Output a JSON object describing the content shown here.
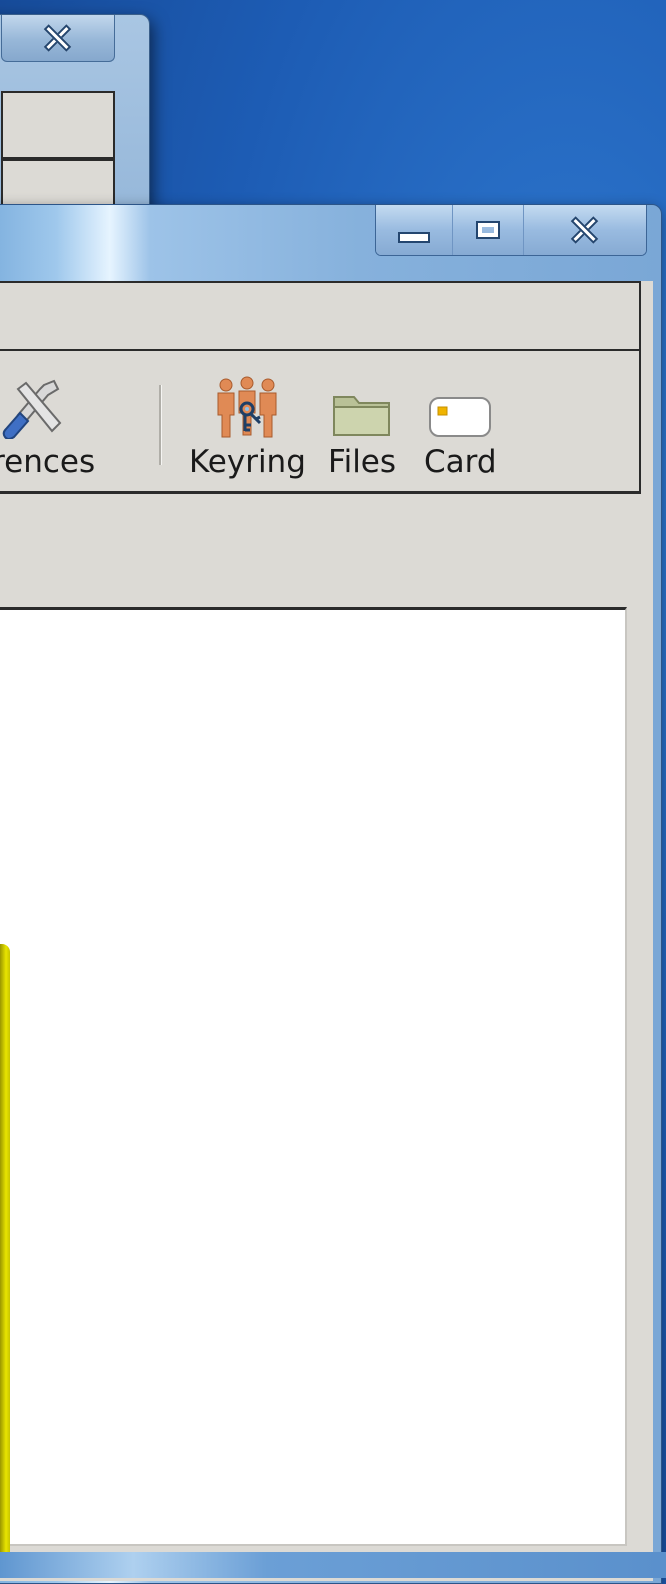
{
  "back_window": {
    "close_icon": "close-icon"
  },
  "main_window": {
    "caption_buttons": {
      "minimize_icon": "minimize-icon",
      "maximize_icon": "maximize-icon",
      "close_icon": "close-icon"
    },
    "toolbar": {
      "items": [
        {
          "label": "erences",
          "icon": "preferences-tools-icon"
        },
        {
          "label": "Keyring",
          "icon": "keyring-people-icon"
        },
        {
          "label": "Files",
          "icon": "folder-icon"
        },
        {
          "label": "Card",
          "icon": "smart-card-icon"
        }
      ]
    }
  },
  "colors": {
    "desktop": "#1d5cb4",
    "window_chrome": "#86b1dc",
    "client_bg": "#dcdad5",
    "content_bg": "#ffffff",
    "keyring_figures": "#e08a55",
    "folder": "#c8cfa8",
    "card_chip": "#f0b400"
  }
}
